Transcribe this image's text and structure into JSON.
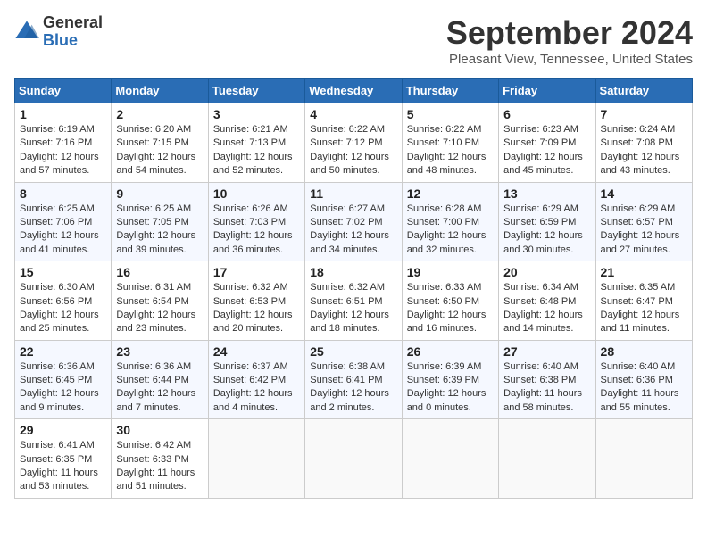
{
  "header": {
    "logo_general": "General",
    "logo_blue": "Blue",
    "title": "September 2024",
    "subtitle": "Pleasant View, Tennessee, United States"
  },
  "days_of_week": [
    "Sunday",
    "Monday",
    "Tuesday",
    "Wednesday",
    "Thursday",
    "Friday",
    "Saturday"
  ],
  "weeks": [
    [
      {
        "day": 1,
        "info": "Sunrise: 6:19 AM\nSunset: 7:16 PM\nDaylight: 12 hours\nand 57 minutes."
      },
      {
        "day": 2,
        "info": "Sunrise: 6:20 AM\nSunset: 7:15 PM\nDaylight: 12 hours\nand 54 minutes."
      },
      {
        "day": 3,
        "info": "Sunrise: 6:21 AM\nSunset: 7:13 PM\nDaylight: 12 hours\nand 52 minutes."
      },
      {
        "day": 4,
        "info": "Sunrise: 6:22 AM\nSunset: 7:12 PM\nDaylight: 12 hours\nand 50 minutes."
      },
      {
        "day": 5,
        "info": "Sunrise: 6:22 AM\nSunset: 7:10 PM\nDaylight: 12 hours\nand 48 minutes."
      },
      {
        "day": 6,
        "info": "Sunrise: 6:23 AM\nSunset: 7:09 PM\nDaylight: 12 hours\nand 45 minutes."
      },
      {
        "day": 7,
        "info": "Sunrise: 6:24 AM\nSunset: 7:08 PM\nDaylight: 12 hours\nand 43 minutes."
      }
    ],
    [
      {
        "day": 8,
        "info": "Sunrise: 6:25 AM\nSunset: 7:06 PM\nDaylight: 12 hours\nand 41 minutes."
      },
      {
        "day": 9,
        "info": "Sunrise: 6:25 AM\nSunset: 7:05 PM\nDaylight: 12 hours\nand 39 minutes."
      },
      {
        "day": 10,
        "info": "Sunrise: 6:26 AM\nSunset: 7:03 PM\nDaylight: 12 hours\nand 36 minutes."
      },
      {
        "day": 11,
        "info": "Sunrise: 6:27 AM\nSunset: 7:02 PM\nDaylight: 12 hours\nand 34 minutes."
      },
      {
        "day": 12,
        "info": "Sunrise: 6:28 AM\nSunset: 7:00 PM\nDaylight: 12 hours\nand 32 minutes."
      },
      {
        "day": 13,
        "info": "Sunrise: 6:29 AM\nSunset: 6:59 PM\nDaylight: 12 hours\nand 30 minutes."
      },
      {
        "day": 14,
        "info": "Sunrise: 6:29 AM\nSunset: 6:57 PM\nDaylight: 12 hours\nand 27 minutes."
      }
    ],
    [
      {
        "day": 15,
        "info": "Sunrise: 6:30 AM\nSunset: 6:56 PM\nDaylight: 12 hours\nand 25 minutes."
      },
      {
        "day": 16,
        "info": "Sunrise: 6:31 AM\nSunset: 6:54 PM\nDaylight: 12 hours\nand 23 minutes."
      },
      {
        "day": 17,
        "info": "Sunrise: 6:32 AM\nSunset: 6:53 PM\nDaylight: 12 hours\nand 20 minutes."
      },
      {
        "day": 18,
        "info": "Sunrise: 6:32 AM\nSunset: 6:51 PM\nDaylight: 12 hours\nand 18 minutes."
      },
      {
        "day": 19,
        "info": "Sunrise: 6:33 AM\nSunset: 6:50 PM\nDaylight: 12 hours\nand 16 minutes."
      },
      {
        "day": 20,
        "info": "Sunrise: 6:34 AM\nSunset: 6:48 PM\nDaylight: 12 hours\nand 14 minutes."
      },
      {
        "day": 21,
        "info": "Sunrise: 6:35 AM\nSunset: 6:47 PM\nDaylight: 12 hours\nand 11 minutes."
      }
    ],
    [
      {
        "day": 22,
        "info": "Sunrise: 6:36 AM\nSunset: 6:45 PM\nDaylight: 12 hours\nand 9 minutes."
      },
      {
        "day": 23,
        "info": "Sunrise: 6:36 AM\nSunset: 6:44 PM\nDaylight: 12 hours\nand 7 minutes."
      },
      {
        "day": 24,
        "info": "Sunrise: 6:37 AM\nSunset: 6:42 PM\nDaylight: 12 hours\nand 4 minutes."
      },
      {
        "day": 25,
        "info": "Sunrise: 6:38 AM\nSunset: 6:41 PM\nDaylight: 12 hours\nand 2 minutes."
      },
      {
        "day": 26,
        "info": "Sunrise: 6:39 AM\nSunset: 6:39 PM\nDaylight: 12 hours\nand 0 minutes."
      },
      {
        "day": 27,
        "info": "Sunrise: 6:40 AM\nSunset: 6:38 PM\nDaylight: 11 hours\nand 58 minutes."
      },
      {
        "day": 28,
        "info": "Sunrise: 6:40 AM\nSunset: 6:36 PM\nDaylight: 11 hours\nand 55 minutes."
      }
    ],
    [
      {
        "day": 29,
        "info": "Sunrise: 6:41 AM\nSunset: 6:35 PM\nDaylight: 11 hours\nand 53 minutes."
      },
      {
        "day": 30,
        "info": "Sunrise: 6:42 AM\nSunset: 6:33 PM\nDaylight: 11 hours\nand 51 minutes."
      },
      null,
      null,
      null,
      null,
      null
    ]
  ]
}
